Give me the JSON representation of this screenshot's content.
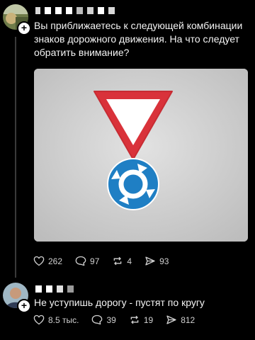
{
  "post": {
    "text": "Вы приближаетесь к следующей комбинации знаков дорожного движения. На что следует обратить внимание?",
    "likes": "262",
    "comments": "97",
    "reposts": "4",
    "shares": "93"
  },
  "reply": {
    "text": "Не уступишь дорогу - пустят по кругу",
    "likes": "8.5 тыс.",
    "comments": "39",
    "reposts": "19",
    "shares": "812"
  },
  "icons": {
    "like": "heart-icon",
    "comment": "comment-icon",
    "repost": "repost-icon",
    "share": "share-icon",
    "follow": "plus-icon"
  },
  "colors": {
    "background": "#000000",
    "sign_red": "#d9323a",
    "sign_blue": "#1f7fc4"
  }
}
